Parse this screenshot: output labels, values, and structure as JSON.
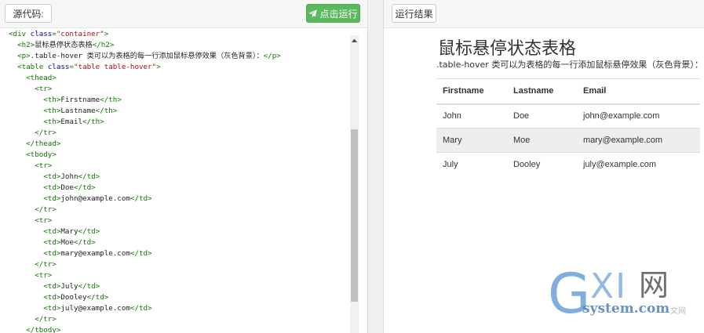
{
  "left_toolbar": {
    "source_label": "源代码:",
    "run_label": "点击运行"
  },
  "code_lines": [
    [
      [
        "tag",
        "<div "
      ],
      [
        "attr",
        "class"
      ],
      [
        "tag",
        "="
      ],
      [
        "str",
        "\"container\""
      ],
      [
        "tag",
        ">"
      ]
    ],
    [
      [
        "tag",
        "  <h2>"
      ],
      [
        "txt",
        "鼠标悬停状态表格"
      ],
      [
        "tag",
        "</h2>"
      ]
    ],
    [
      [
        "tag",
        "  <p>"
      ],
      [
        "txt",
        ".table-hover 类可以为表格的每一行添加鼠标悬停效果（灰色背景）："
      ],
      [
        "tag",
        "</p>"
      ]
    ],
    [
      [
        "tag",
        "  <table "
      ],
      [
        "attr",
        "class"
      ],
      [
        "tag",
        "="
      ],
      [
        "str",
        "\"table table-hover\""
      ],
      [
        "tag",
        ">"
      ]
    ],
    [
      [
        "tag",
        "    <thead>"
      ]
    ],
    [
      [
        "tag",
        "      <tr>"
      ]
    ],
    [
      [
        "tag",
        "        <th>"
      ],
      [
        "txt",
        "Firstname"
      ],
      [
        "tag",
        "</th>"
      ]
    ],
    [
      [
        "tag",
        "        <th>"
      ],
      [
        "txt",
        "Lastname"
      ],
      [
        "tag",
        "</th>"
      ]
    ],
    [
      [
        "tag",
        "        <th>"
      ],
      [
        "txt",
        "Email"
      ],
      [
        "tag",
        "</th>"
      ]
    ],
    [
      [
        "tag",
        "      </tr>"
      ]
    ],
    [
      [
        "tag",
        "    </thead>"
      ]
    ],
    [
      [
        "tag",
        "    <tbody>"
      ]
    ],
    [
      [
        "tag",
        "      <tr>"
      ]
    ],
    [
      [
        "tag",
        "        <td>"
      ],
      [
        "txt",
        "John"
      ],
      [
        "tag",
        "</td>"
      ]
    ],
    [
      [
        "tag",
        "        <td>"
      ],
      [
        "txt",
        "Doe"
      ],
      [
        "tag",
        "</td>"
      ]
    ],
    [
      [
        "tag",
        "        <td>"
      ],
      [
        "txt",
        "john@example.com"
      ],
      [
        "tag",
        "</td>"
      ]
    ],
    [
      [
        "tag",
        "      </tr>"
      ]
    ],
    [
      [
        "tag",
        "      <tr>"
      ]
    ],
    [
      [
        "tag",
        "        <td>"
      ],
      [
        "txt",
        "Mary"
      ],
      [
        "tag",
        "</td>"
      ]
    ],
    [
      [
        "tag",
        "        <td>"
      ],
      [
        "txt",
        "Moe"
      ],
      [
        "tag",
        "</td>"
      ]
    ],
    [
      [
        "tag",
        "        <td>"
      ],
      [
        "txt",
        "mary@example.com"
      ],
      [
        "tag",
        "</td>"
      ]
    ],
    [
      [
        "tag",
        "      </tr>"
      ]
    ],
    [
      [
        "tag",
        "      <tr>"
      ]
    ],
    [
      [
        "tag",
        "        <td>"
      ],
      [
        "txt",
        "July"
      ],
      [
        "tag",
        "</td>"
      ]
    ],
    [
      [
        "tag",
        "        <td>"
      ],
      [
        "txt",
        "Dooley"
      ],
      [
        "tag",
        "</td>"
      ]
    ],
    [
      [
        "tag",
        "        <td>"
      ],
      [
        "txt",
        "july@example.com"
      ],
      [
        "tag",
        "</td>"
      ]
    ],
    [
      [
        "tag",
        "      </tr>"
      ]
    ],
    [
      [
        "tag",
        "    </tbody>"
      ]
    ]
  ],
  "right_toolbar": {
    "result_label": "运行结果"
  },
  "result": {
    "title": "鼠标悬停状态表格",
    "description": ".table-hover 类可以为表格的每一行添加鼠标悬停效果（灰色背景）：",
    "headers": [
      "Firstname",
      "Lastname",
      "Email"
    ],
    "rows": [
      [
        "John",
        "Doe",
        "john@example.com"
      ],
      [
        "Mary",
        "Moe",
        "mary@example.com"
      ],
      [
        "July",
        "Dooley",
        "july@example.com"
      ]
    ],
    "hovered_row": 1
  },
  "watermark": {
    "g": "G",
    "xi": "XI",
    "wang": "网",
    "domain": "system.com",
    "extra": "文网"
  },
  "colors": {
    "run_button": "#5cb85c",
    "code_tag": "#117700",
    "code_attr": "#0000cc",
    "code_string": "#aa1111",
    "hover_row": "#eeeeee"
  },
  "icons": {
    "run": "paper-plane-icon",
    "scroll_up": "triangle-up-icon"
  }
}
